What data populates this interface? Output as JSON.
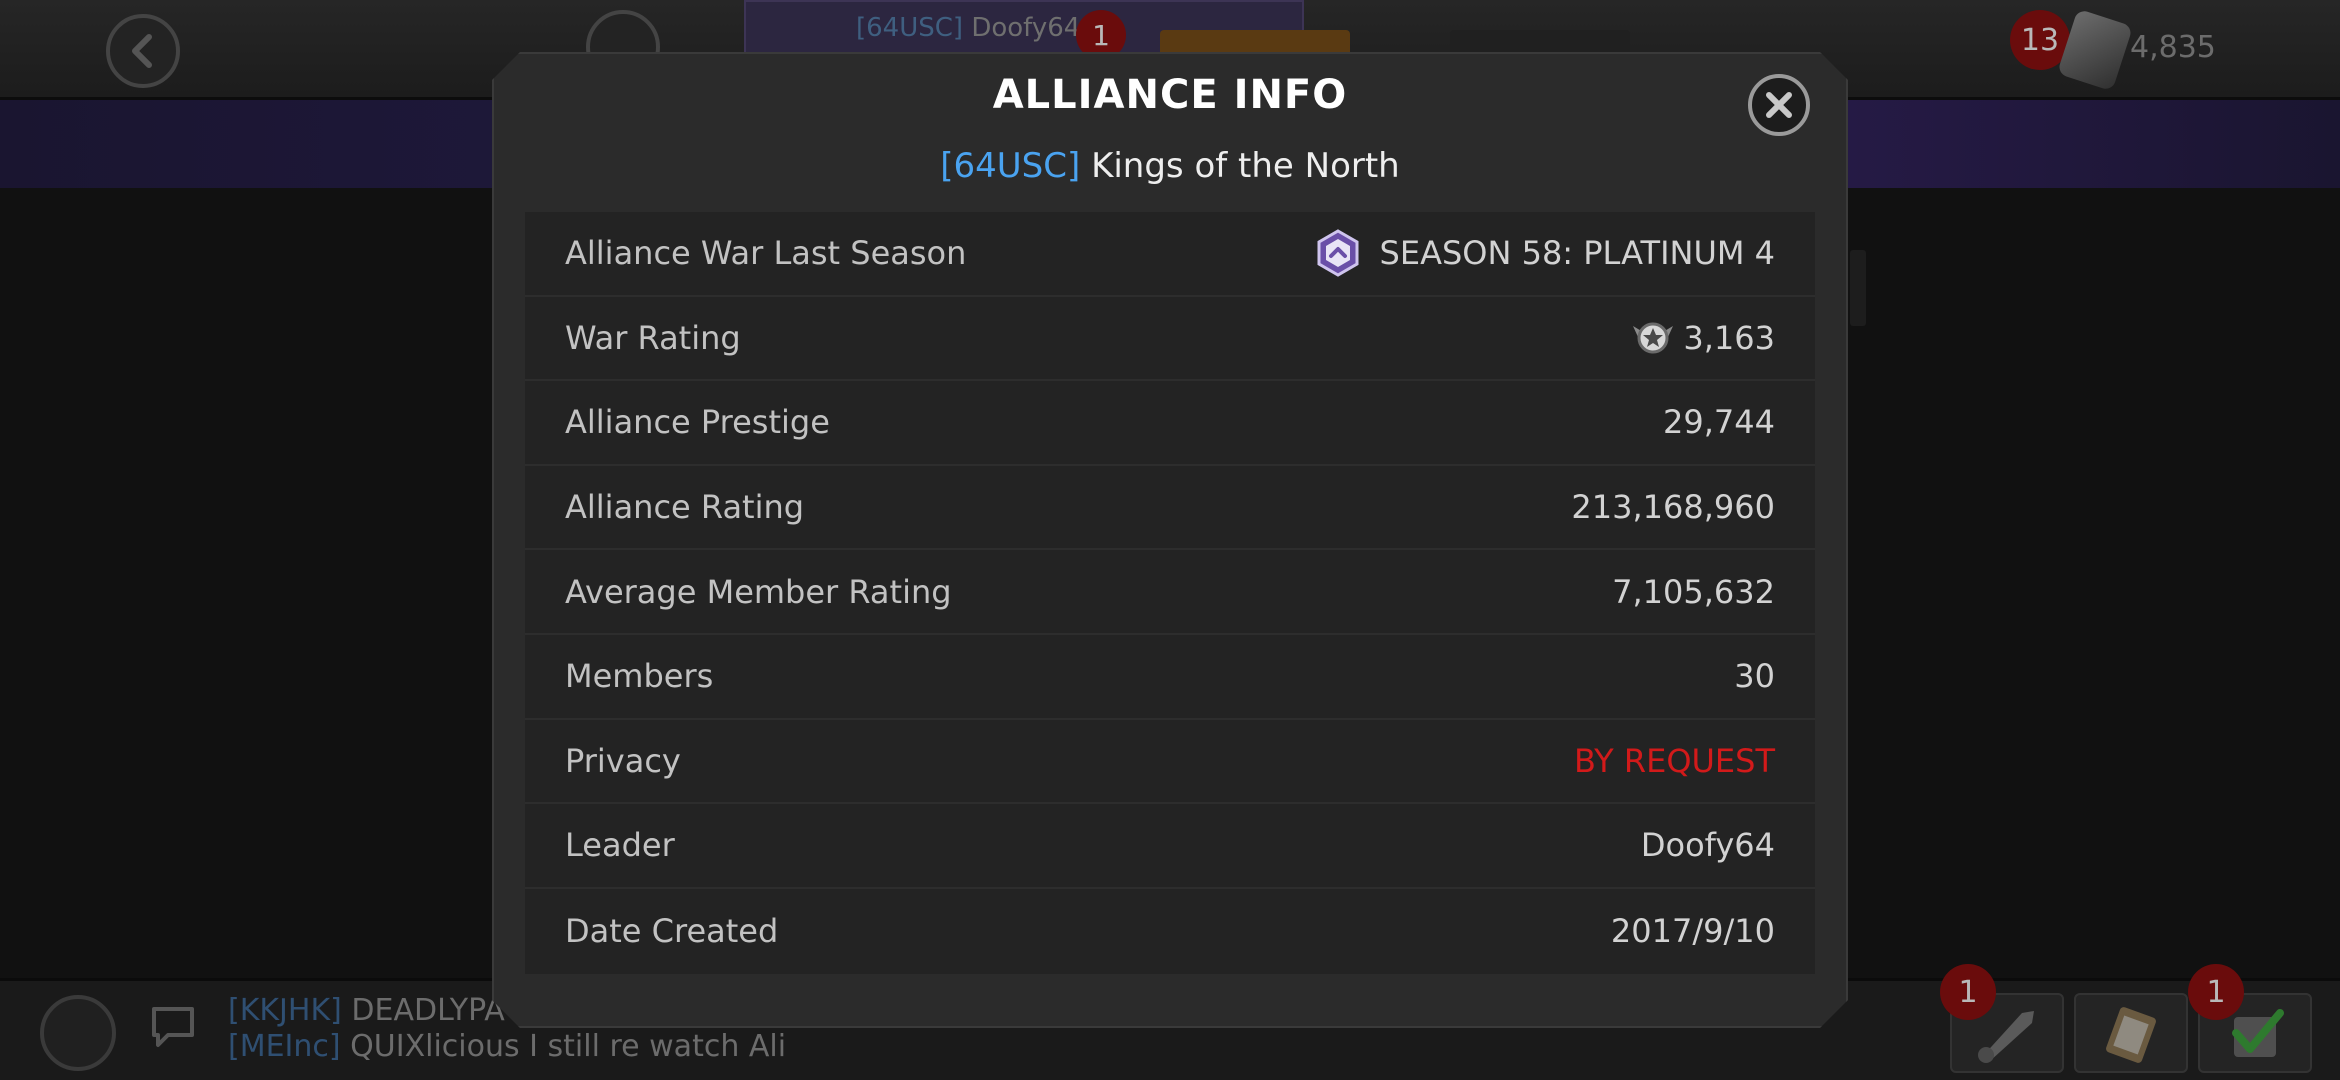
{
  "header": {
    "player_tag": "[64USC]",
    "player_name": "Doofy64",
    "player_notifications": "1",
    "units_notifications": "13",
    "units": "4,835"
  },
  "modal": {
    "title": "ALLIANCE INFO",
    "alliance_tag": "[64USC]",
    "alliance_name": "Kings of the North",
    "rows": [
      {
        "label": "Alliance War Last Season",
        "value": "SEASON 58: PLATINUM 4",
        "icon": "platinum-tier-icon"
      },
      {
        "label": "War Rating",
        "value": "3,163",
        "icon": "war-rating-icon"
      },
      {
        "label": "Alliance Prestige",
        "value": "29,744"
      },
      {
        "label": "Alliance Rating",
        "value": "213,168,960"
      },
      {
        "label": "Average Member Rating",
        "value": "7,105,632"
      },
      {
        "label": "Members",
        "value": "30"
      },
      {
        "label": "Privacy",
        "value": "BY REQUEST",
        "color": "#d21a1a"
      },
      {
        "label": "Leader",
        "value": "Doofy64"
      },
      {
        "label": "Date Created",
        "value": "2017/9/10"
      }
    ]
  },
  "chat": {
    "line1_tag": "[KKJHK]",
    "line1_text": "DEADLYPA",
    "line2_tag": "[MEInc]",
    "line2_text": "QUIXlicious  I still re watch Ali"
  },
  "quick_actions": {
    "badge_1": "1",
    "badge_3": "1"
  },
  "colors": {
    "accent_blue": "#4aa3f0",
    "privacy_red": "#d21a1a",
    "modal_bg": "#2b2b2b"
  }
}
